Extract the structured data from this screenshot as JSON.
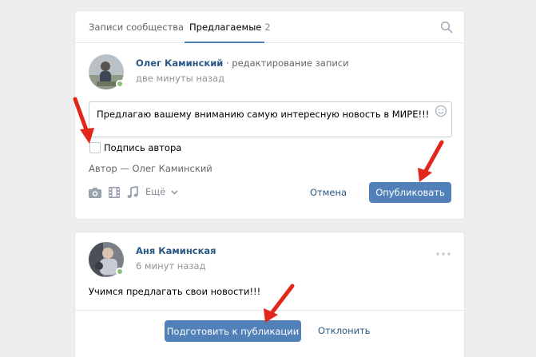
{
  "tabs": {
    "community_posts": "Записи сообщества",
    "suggested": "Предлагаемые",
    "suggested_count": "2"
  },
  "editor_post": {
    "author": "Олег Каминский",
    "action": " · редактирование записи",
    "time": "две минуты назад",
    "text": "Предлагаю вашему вниманию самую интересную новость в МИРЕ!!!",
    "signature_checkbox_label": "Подпись автора",
    "signature_line": "Автор — Олег Каминский",
    "more_label": "Ещё",
    "cancel_label": "Отмена",
    "publish_label": "Опубликовать"
  },
  "suggested_post": {
    "author": "Аня Каминская",
    "time": "6 минут назад",
    "text": "Учимся предлагать свои новости!!!",
    "prepare_label": "Подготовить к публикации",
    "reject_label": "Отклонить"
  },
  "colors": {
    "accent": "#5181b8",
    "link": "#2a5885",
    "annotation_arrow": "#e3261b",
    "online": "#8ac176"
  },
  "icons": [
    "search-icon",
    "emoji-icon",
    "camera-icon",
    "video-icon",
    "music-icon",
    "chevron-down-icon",
    "more-dots-icon"
  ]
}
